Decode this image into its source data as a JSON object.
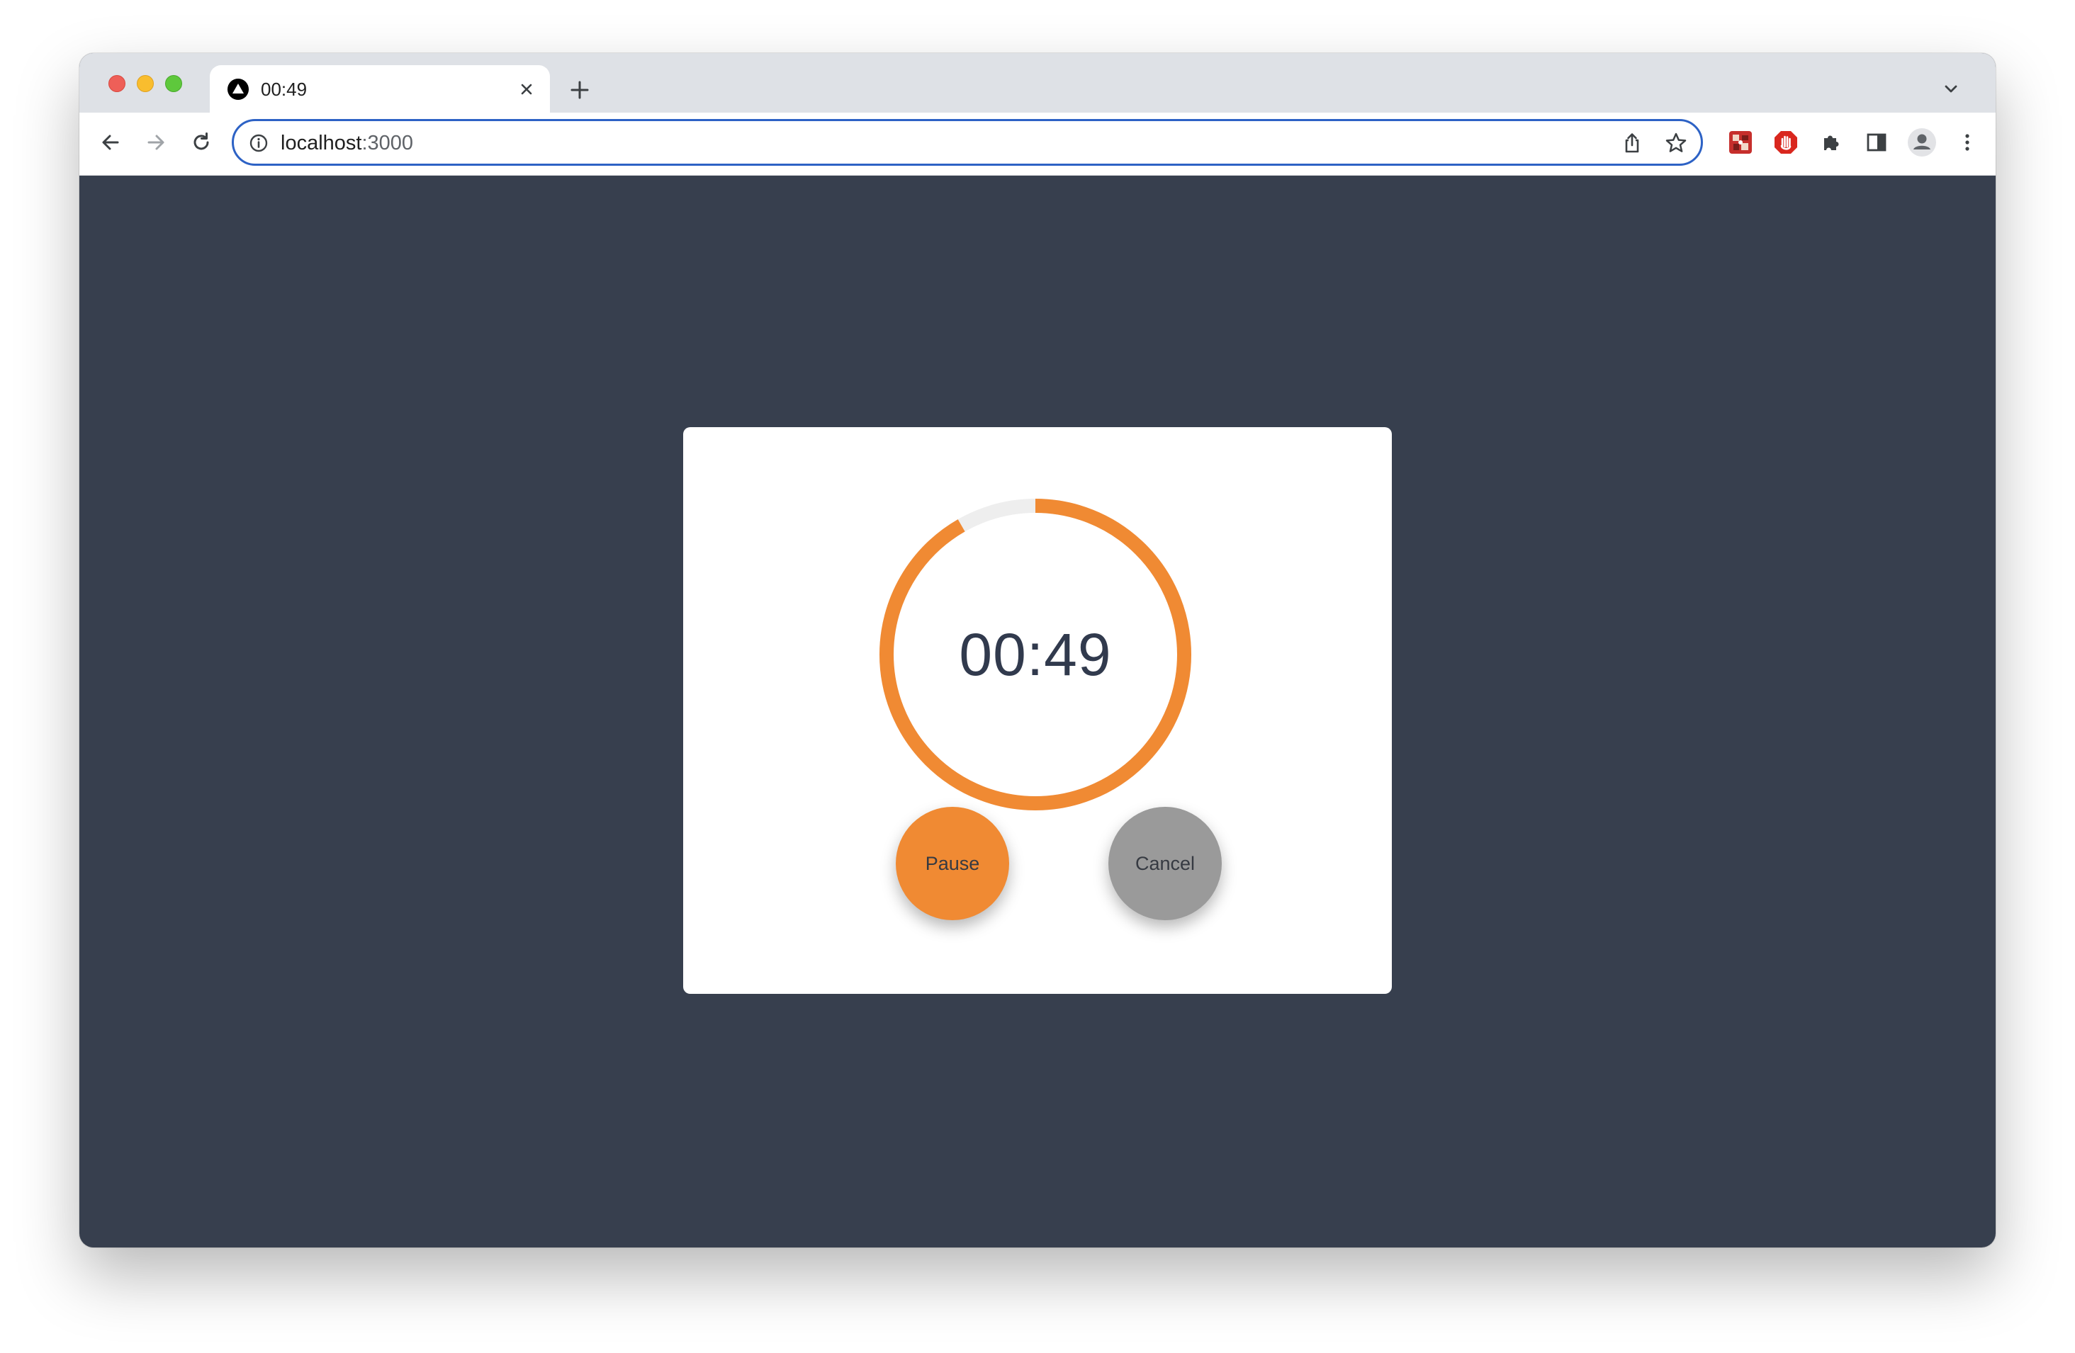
{
  "browser": {
    "tab": {
      "title": "00:49",
      "favicon_icon": "triangle-logo-icon"
    },
    "address_bar": {
      "host": "localhost",
      "port": ":3000"
    },
    "icons": {
      "back": "arrow-left-icon",
      "forward": "arrow-right-icon",
      "reload": "reload-icon",
      "info": "info-icon",
      "share": "share-icon",
      "bookmark": "star-icon",
      "extension_1": "puzzle-app-extension-icon",
      "extension_2": "hand-stop-extension-icon",
      "extensions": "puzzle-icon",
      "side_panel": "side-panel-icon",
      "profile": "profile-avatar-icon",
      "menu": "more-vertical-icon",
      "tab_list": "chevron-down-icon",
      "new_tab": "plus-icon",
      "close_tab": "close-icon"
    }
  },
  "timer": {
    "display": "00:49",
    "progress_fraction": 0.917,
    "pause_label": "Pause",
    "cancel_label": "Cancel"
  },
  "colors": {
    "page_background": "#373f4e",
    "card_background": "#ffffff",
    "ring_progress": "#f08a33",
    "ring_track": "#eeeeee",
    "pause_button": "#f08a33",
    "cancel_button": "#9a9a9a",
    "time_text": "#313a4d",
    "omnibox_focus": "#2d62c5"
  }
}
